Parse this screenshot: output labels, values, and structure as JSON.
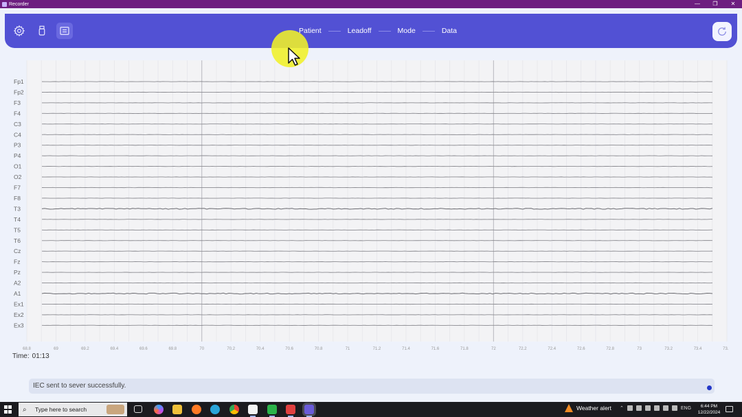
{
  "window": {
    "title": "Recorder",
    "controls": [
      "—",
      "❐",
      "✕"
    ]
  },
  "header": {
    "icons": [
      "gear-icon",
      "usb-icon",
      "monitor-icon"
    ],
    "steps": [
      "Patient",
      "Leadoff",
      "Mode",
      "Data"
    ],
    "reset_icon": "refresh-icon",
    "accent_color": "#5251d4"
  },
  "chart_data": {
    "type": "line",
    "channels": [
      "Fp1",
      "Fp2",
      "F3",
      "F4",
      "C3",
      "C4",
      "P3",
      "P4",
      "O1",
      "O2",
      "F7",
      "F8",
      "T3",
      "T4",
      "T5",
      "T6",
      "Cz",
      "Fz",
      "Pz",
      "A2",
      "A1",
      "Ex1",
      "Ex2",
      "Ex3"
    ],
    "x_ticks": [
      "68.8",
      "69",
      "69.2",
      "69.4",
      "69.6",
      "69.8",
      "70",
      "70.2",
      "70.4",
      "70.6",
      "70.8",
      "71",
      "71.2",
      "71.4",
      "71.6",
      "71.8",
      "72",
      "72.2",
      "72.4",
      "72.6",
      "72.8",
      "73",
      "73.2",
      "73.4",
      "73.6"
    ],
    "xlim": [
      68.8,
      73.6
    ],
    "grid": true
  },
  "time": {
    "label": "Time:",
    "value": "01:13"
  },
  "status": {
    "message": "IEC sent to sever successfully."
  },
  "taskbar": {
    "search_placeholder": "Type here to search",
    "weather": "Weather alert",
    "lang": "ENG",
    "time": "6:44 PM",
    "date": "12/22/2024"
  }
}
